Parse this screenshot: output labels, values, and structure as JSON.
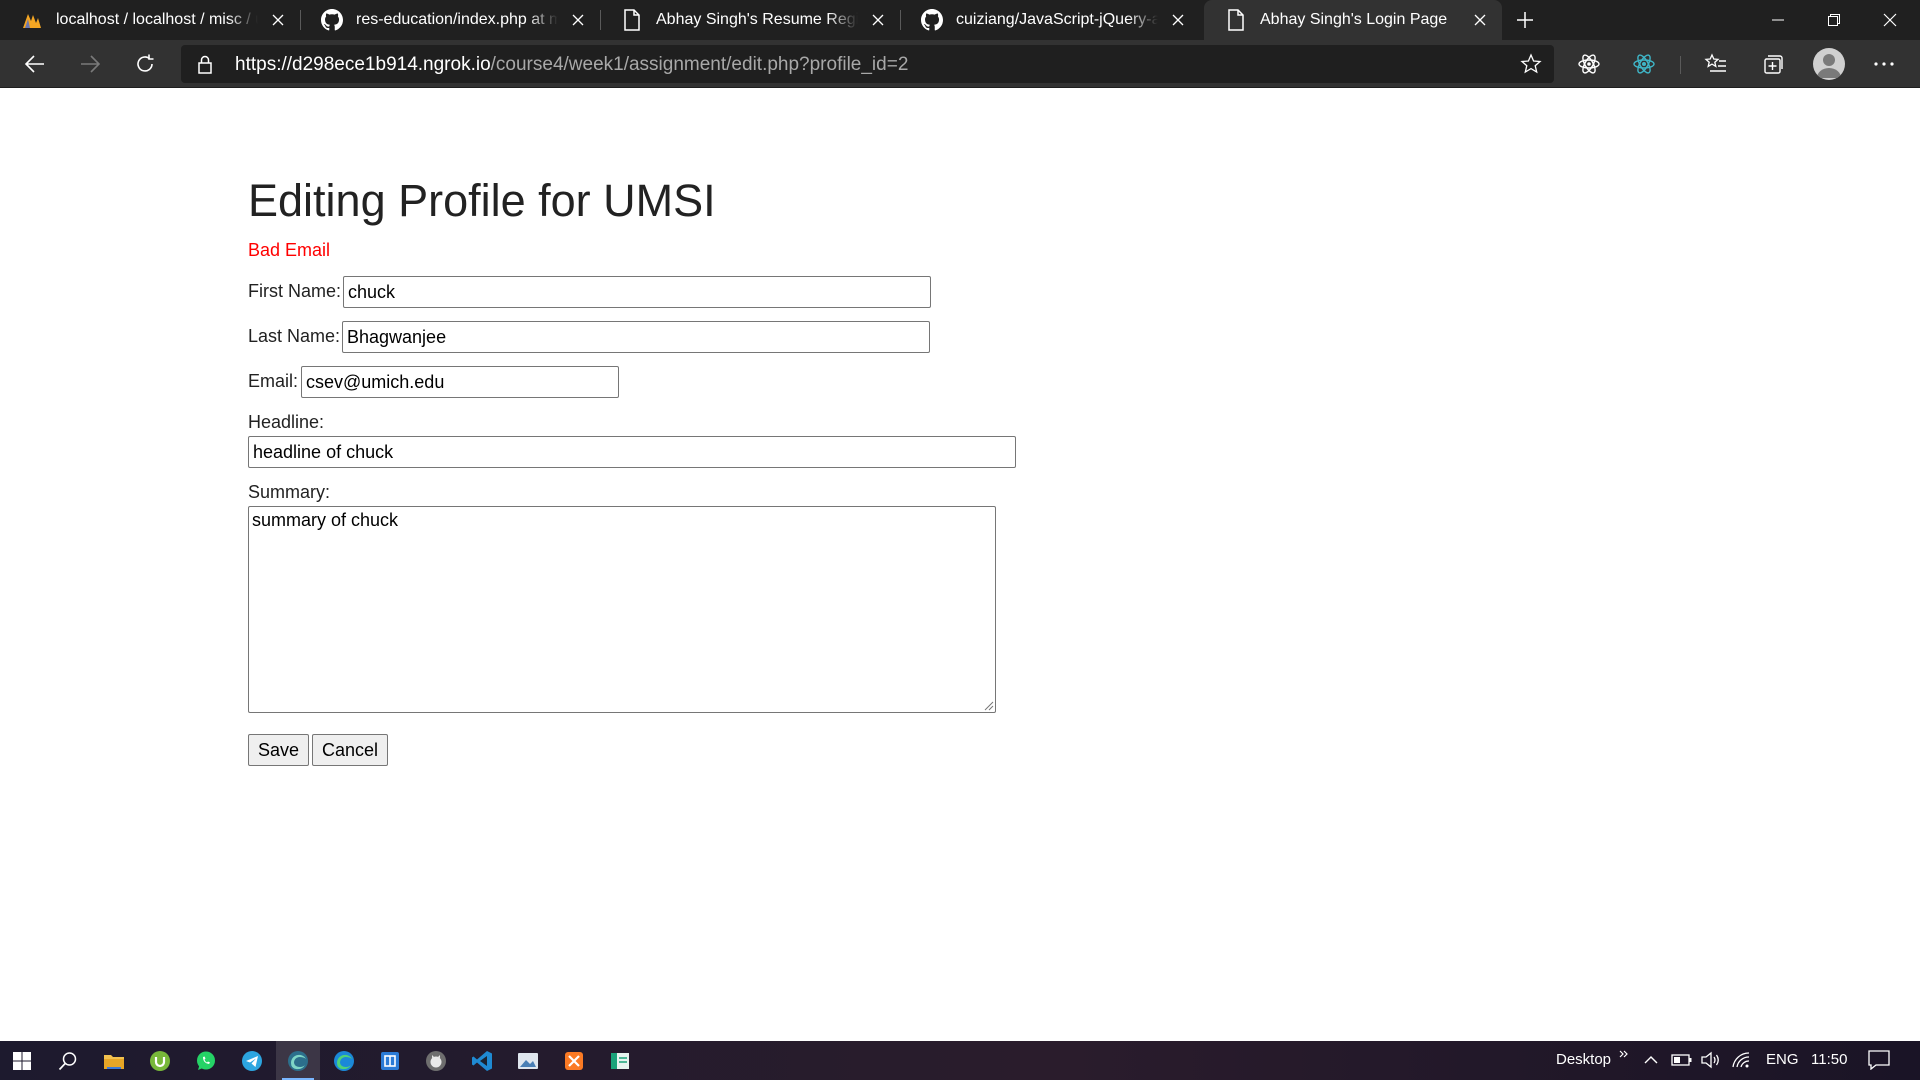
{
  "browser": {
    "tabs": [
      {
        "title": "localhost / localhost / misc / users | phpMyAdmin",
        "favicon": "phpmyadmin-icon"
      },
      {
        "title": "res-education/index.php at master",
        "favicon": "github-icon"
      },
      {
        "title": "Abhay Singh's Resume Registry",
        "favicon": "page-icon"
      },
      {
        "title": "cuiziang/JavaScript-jQuery-and-JSON",
        "favicon": "github-icon"
      },
      {
        "title": "Abhay Singh's Login Page",
        "favicon": "page-icon",
        "active": true
      }
    ],
    "address": {
      "scheme": "https://",
      "host": "d298ece1b914.ngrok.io",
      "path": "/course4/week1/assignment/edit.php?profile_id=2"
    }
  },
  "page": {
    "heading": "Editing Profile for UMSI",
    "error": "Bad Email",
    "error_color": "#ff0000",
    "form": {
      "first_name_label": "First Name:",
      "first_name_value": "chuck",
      "last_name_label": "Last Name:",
      "last_name_value": "Bhagwanjee",
      "email_label": "Email:",
      "email_value": "csev@umich.edu",
      "headline_label": "Headline:",
      "headline_value": "headline of chuck",
      "summary_label": "Summary:",
      "summary_value": "summary of chuck",
      "save_label": "Save",
      "cancel_label": "Cancel"
    }
  },
  "taskbar": {
    "desktop_label": "Desktop",
    "language": "ENG",
    "time": "11:50"
  }
}
